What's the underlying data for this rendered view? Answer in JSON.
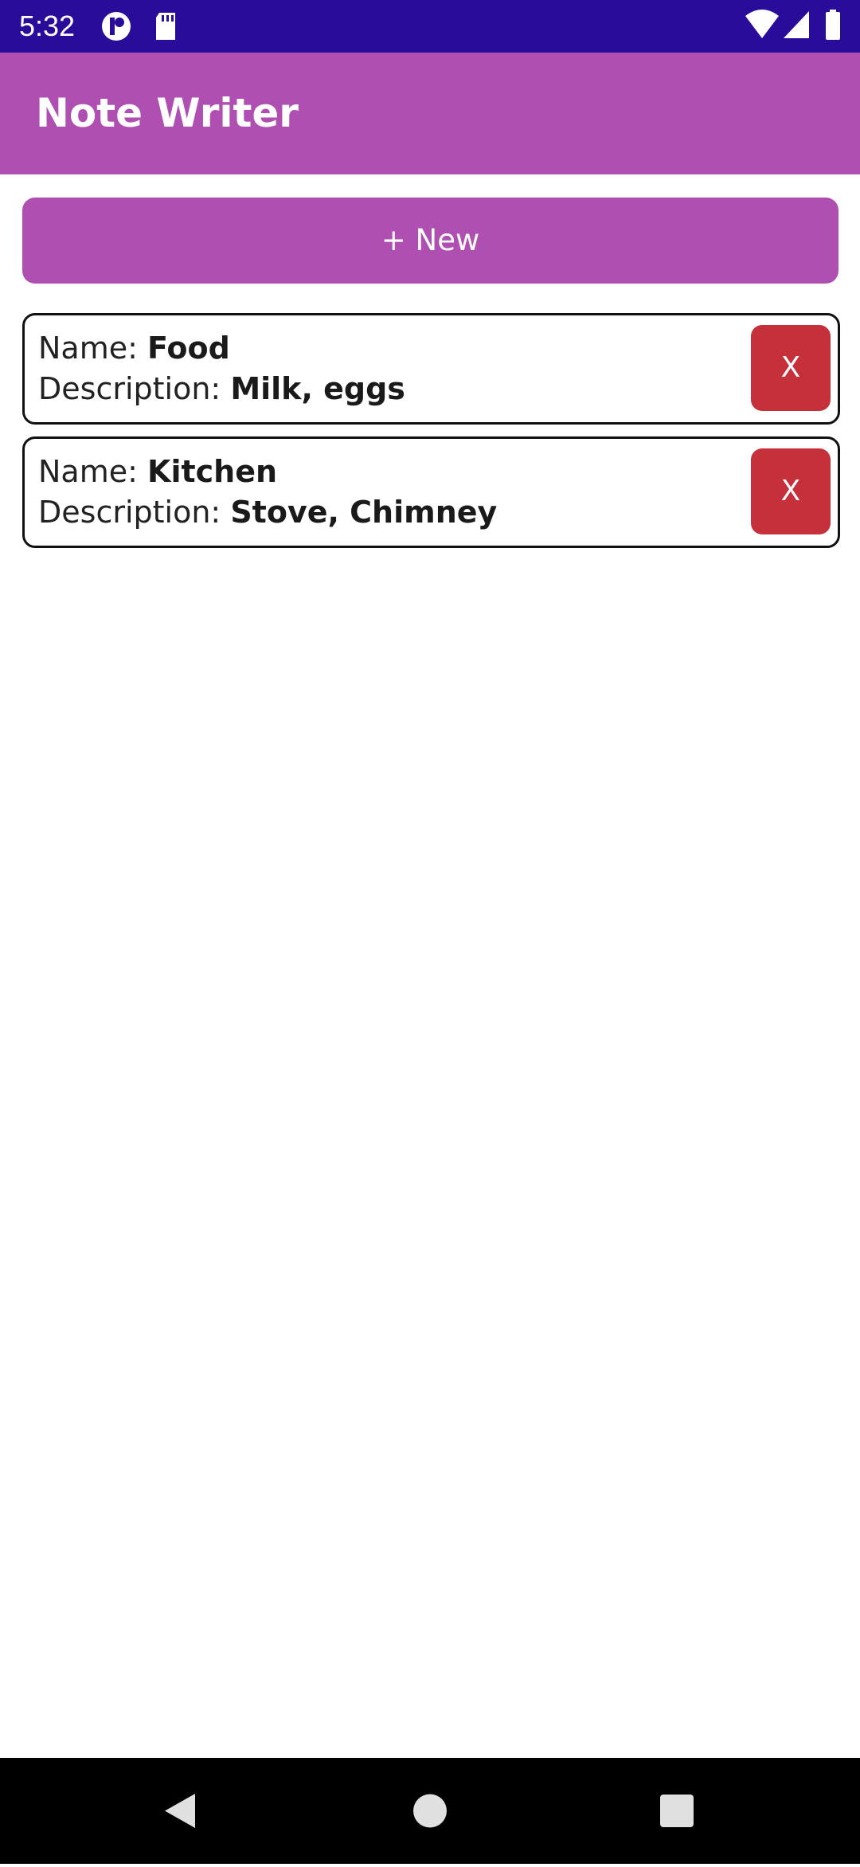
{
  "status_bar": {
    "time": "5:32",
    "icons": [
      "notification-icon",
      "sd-card-icon",
      "wifi-icon",
      "signal-icon",
      "battery-icon"
    ]
  },
  "app_bar": {
    "title": "Note Writer"
  },
  "new_button": {
    "label": "+ New"
  },
  "notes": [
    {
      "name_label": "Name: ",
      "name": "Food",
      "description_label": "Description: ",
      "description": "Milk, eggs",
      "delete_label": "X"
    },
    {
      "name_label": "Name: ",
      "name": "Kitchen",
      "description_label": "Description: ",
      "description": "Stove, Chimney",
      "delete_label": "X"
    }
  ],
  "nav_bar": {
    "buttons": [
      "back-icon",
      "home-icon",
      "recents-icon"
    ]
  },
  "colors": {
    "status_bar": "#2a0c9b",
    "accent": "#ae4fb1",
    "delete": "#c5303a"
  }
}
